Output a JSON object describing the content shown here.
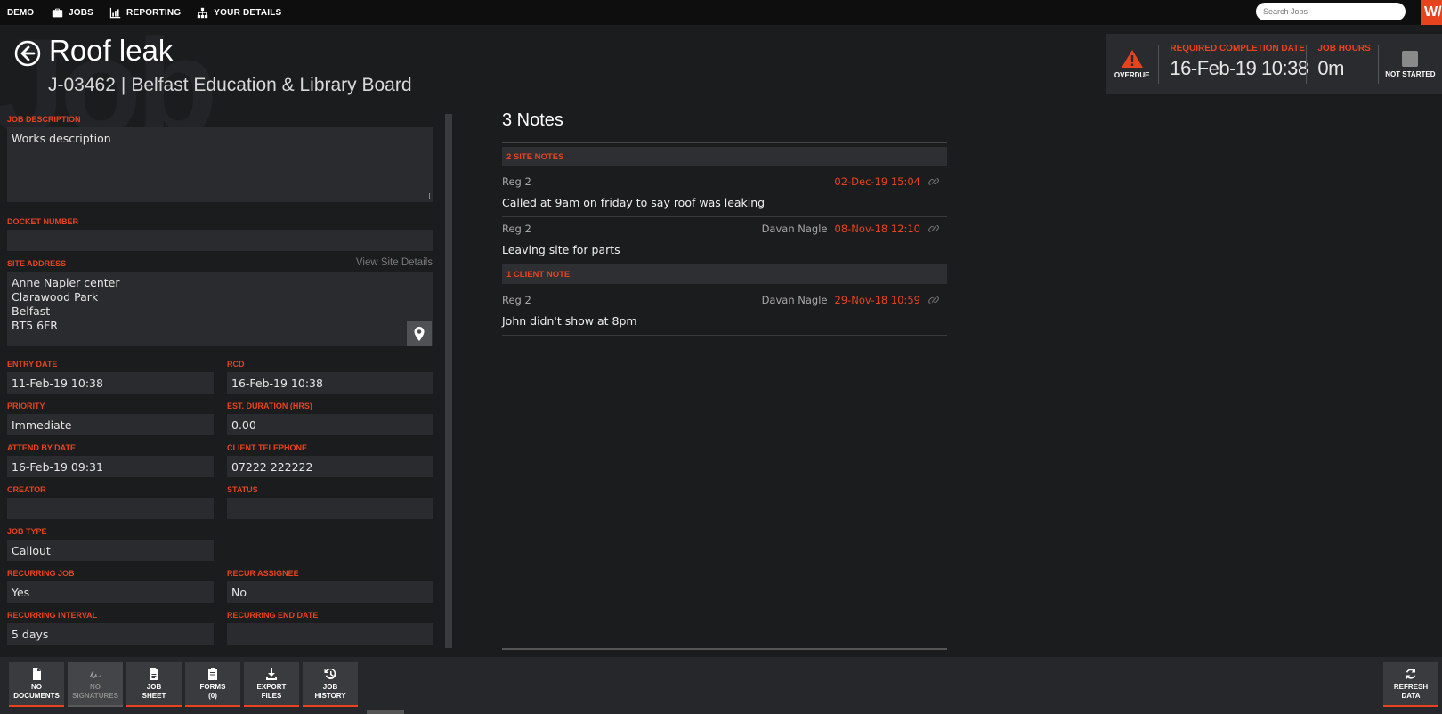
{
  "nav": {
    "brand": "DEMO",
    "items": [
      {
        "label": "JOBS",
        "icon": "briefcase-icon"
      },
      {
        "label": "REPORTING",
        "icon": "bar-chart-icon"
      },
      {
        "label": "YOUR DETAILS",
        "icon": "org-chart-icon"
      }
    ],
    "search_placeholder": "Search Jobs",
    "logo_text": "W/",
    "accent_color": "#e8431f"
  },
  "watermark": "Job",
  "header": {
    "title": "Roof leak",
    "job_number": "J-03462",
    "separator": "|",
    "client": "Belfast Education & Library Board"
  },
  "status": {
    "overdue_label": "OVERDUE",
    "rcd_label": "REQUIRED COMPLETION DATE",
    "rcd_value": "16-Feb-19 10:38",
    "hours_label": "JOB HOURS",
    "hours_value": "0m",
    "not_started_label": "NOT STARTED"
  },
  "form": {
    "job_description": {
      "label": "JOB DESCRIPTION",
      "value": "Works description"
    },
    "docket_number": {
      "label": "DOCKET NUMBER",
      "value": ""
    },
    "site_address": {
      "label": "SITE ADDRESS",
      "value": "Anne Napier center\nClarawood Park\nBelfast\nBT5 6FR",
      "link": "View Site Details"
    },
    "entry_date": {
      "label": "ENTRY DATE",
      "value": "11-Feb-19 10:38"
    },
    "rcd": {
      "label": "RCD",
      "value": "16-Feb-19 10:38"
    },
    "priority": {
      "label": "PRIORITY",
      "value": "Immediate"
    },
    "est_duration": {
      "label": "EST. DURATION (HRS)",
      "value": "0.00"
    },
    "attend_by_date": {
      "label": "ATTEND BY DATE",
      "value": "16-Feb-19 09:31"
    },
    "client_telephone": {
      "label": "CLIENT TELEPHONE",
      "value": "07222 222222"
    },
    "creator": {
      "label": "CREATOR",
      "value": ""
    },
    "status": {
      "label": "STATUS",
      "value": ""
    },
    "job_type": {
      "label": "JOB TYPE",
      "value": "Callout"
    },
    "recurring_job": {
      "label": "RECURRING JOB",
      "value": "Yes"
    },
    "recur_assignee": {
      "label": "RECUR ASSIGNEE",
      "value": "No"
    },
    "recurring_interval": {
      "label": "RECURRING INTERVAL",
      "value": "5 days"
    },
    "recurring_end_date": {
      "label": "RECURRING END DATE",
      "value": ""
    }
  },
  "notes": {
    "title": "3 Notes",
    "site_header": "2 SITE NOTES",
    "client_header": "1 CLIENT NOTE",
    "site_notes": [
      {
        "reg": "Reg 2",
        "author": "",
        "date": "02-Dec-19 15:04",
        "text": "Called at 9am on friday to say roof was leaking"
      },
      {
        "reg": "Reg 2",
        "author": "Davan Nagle",
        "date": "08-Nov-18 12:10",
        "text": "Leaving site for parts"
      }
    ],
    "client_notes": [
      {
        "reg": "Reg 2",
        "author": "Davan Nagle",
        "date": "29-Nov-18 10:59",
        "text": "John didn't show at 8pm"
      }
    ]
  },
  "toolbar": {
    "buttons": [
      {
        "label": "NO\nDOCUMENTS",
        "icon": "document-icon",
        "disabled": false
      },
      {
        "label": "NO\nSIGNATURES",
        "icon": "signature-icon",
        "disabled": true
      },
      {
        "label": "JOB\nSHEET",
        "icon": "job-sheet-icon",
        "disabled": false
      },
      {
        "label": "FORMS\n(0)",
        "icon": "clipboard-icon",
        "disabled": false
      },
      {
        "label": "EXPORT\nFILES",
        "icon": "download-icon",
        "disabled": false
      },
      {
        "label": "JOB\nHISTORY",
        "icon": "history-icon",
        "disabled": false
      }
    ],
    "refresh": {
      "label": "REFRESH\nDATA",
      "icon": "refresh-icon"
    }
  }
}
